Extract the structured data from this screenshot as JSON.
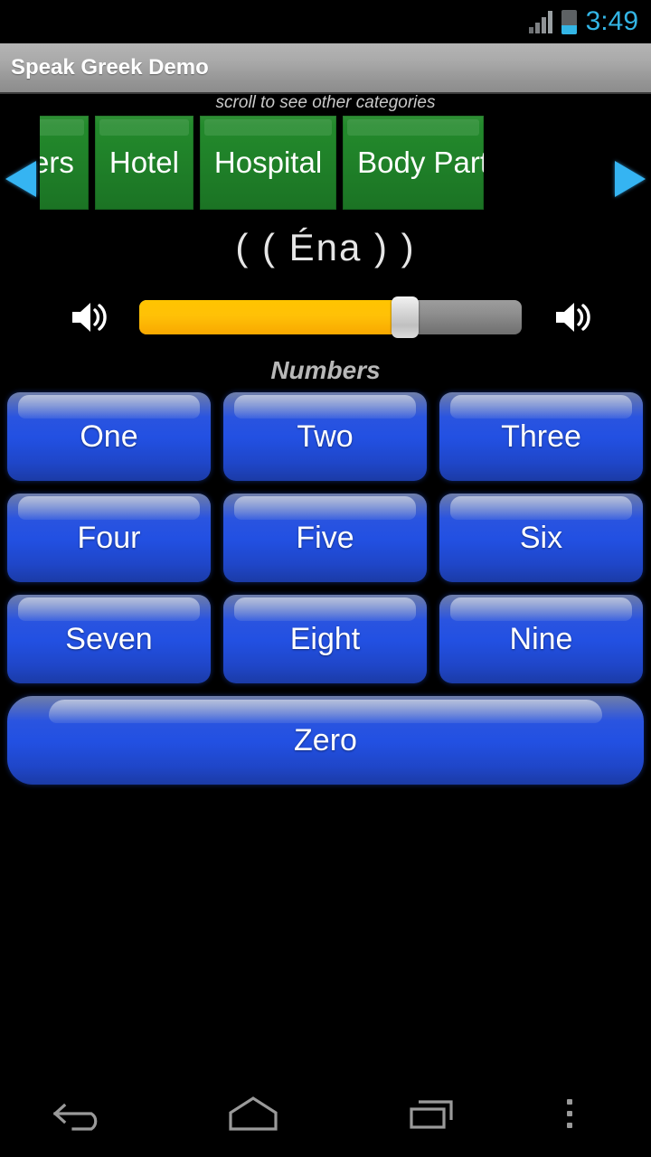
{
  "status_bar": {
    "time": "3:49",
    "signal_icon": "signal-bars-icon",
    "battery_icon": "battery-low-icon",
    "accent_color": "#33b5e5"
  },
  "action_bar": {
    "title": "Speak Greek Demo"
  },
  "categories": {
    "hint": "scroll to see other categories",
    "left_arrow": "scroll-left-arrow-icon",
    "right_arrow": "scroll-right-arrow-icon",
    "accent_color": "#1f7f28",
    "items": [
      {
        "label": "Numbers",
        "clipped": "left"
      },
      {
        "label": "Hotel",
        "clipped": "none"
      },
      {
        "label": "Hospital",
        "clipped": "none"
      },
      {
        "label": "Body Parts",
        "clipped": "right"
      }
    ]
  },
  "word_display": {
    "text": "( ( Éna ) )"
  },
  "volume": {
    "left_icon": "speaker-volume-icon",
    "right_icon": "speaker-volume-icon",
    "value_percent": 71,
    "fill_color": "#ffc107",
    "track_color": "#8e8e8e"
  },
  "section": {
    "label": "Numbers"
  },
  "word_buttons": {
    "accent_color": "#2250e2",
    "items": [
      {
        "label": "One",
        "wide": false
      },
      {
        "label": "Two",
        "wide": false
      },
      {
        "label": "Three",
        "wide": false
      },
      {
        "label": "Four",
        "wide": false
      },
      {
        "label": "Five",
        "wide": false
      },
      {
        "label": "Six",
        "wide": false
      },
      {
        "label": "Seven",
        "wide": false
      },
      {
        "label": "Eight",
        "wide": false
      },
      {
        "label": "Nine",
        "wide": false
      },
      {
        "label": "Zero",
        "wide": true
      }
    ]
  },
  "nav_bar": {
    "back": "back-arrow-icon",
    "home": "home-icon",
    "recents": "recent-apps-icon",
    "overflow": "overflow-menu-icon"
  }
}
